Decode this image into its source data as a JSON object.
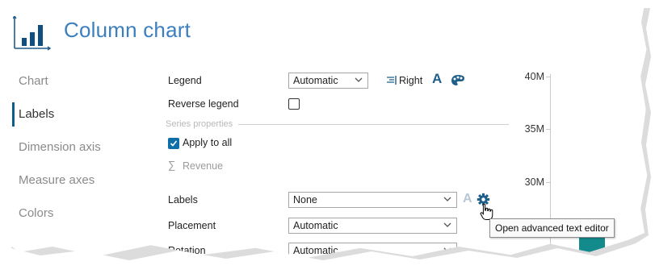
{
  "header": {
    "title": "Column chart",
    "icon": "column-chart-icon"
  },
  "nav": {
    "items": [
      {
        "label": "Chart",
        "active": false
      },
      {
        "label": "Labels",
        "active": true
      },
      {
        "label": "Dimension axis",
        "active": false
      },
      {
        "label": "Measure axes",
        "active": false
      },
      {
        "label": "Colors",
        "active": false
      }
    ]
  },
  "legend": {
    "label": "Legend",
    "select_value": "Automatic",
    "position_label": "Right",
    "position_icon": "align-right-icon",
    "font_icon": "font-icon",
    "palette_icon": "palette-icon"
  },
  "reverse_legend": {
    "label": "Reverse legend",
    "checked": false
  },
  "series_properties": {
    "section_label": "Series properties",
    "apply_to_all": {
      "label": "Apply to all",
      "checked": true
    },
    "series_name": "Revenue",
    "series_icon": "sigma-icon"
  },
  "labels": {
    "label": "Labels",
    "select_value": "None",
    "settings_icon": "gear-icon"
  },
  "placement": {
    "label": "Placement",
    "select_value": "Automatic"
  },
  "rotation": {
    "label": "Rotation",
    "select_value": "Automatic"
  },
  "tooltip": {
    "text": "Open advanced text editor"
  },
  "chart_preview": {
    "ticks": [
      "40M",
      "35M",
      "30M"
    ],
    "bar_color": "#138a8c"
  },
  "colors": {
    "accent": "#3b7fbf",
    "nav_active": "#0e5b8e",
    "checkbox": "#0e6ea8",
    "icon_blue": "#1f5f8b"
  }
}
